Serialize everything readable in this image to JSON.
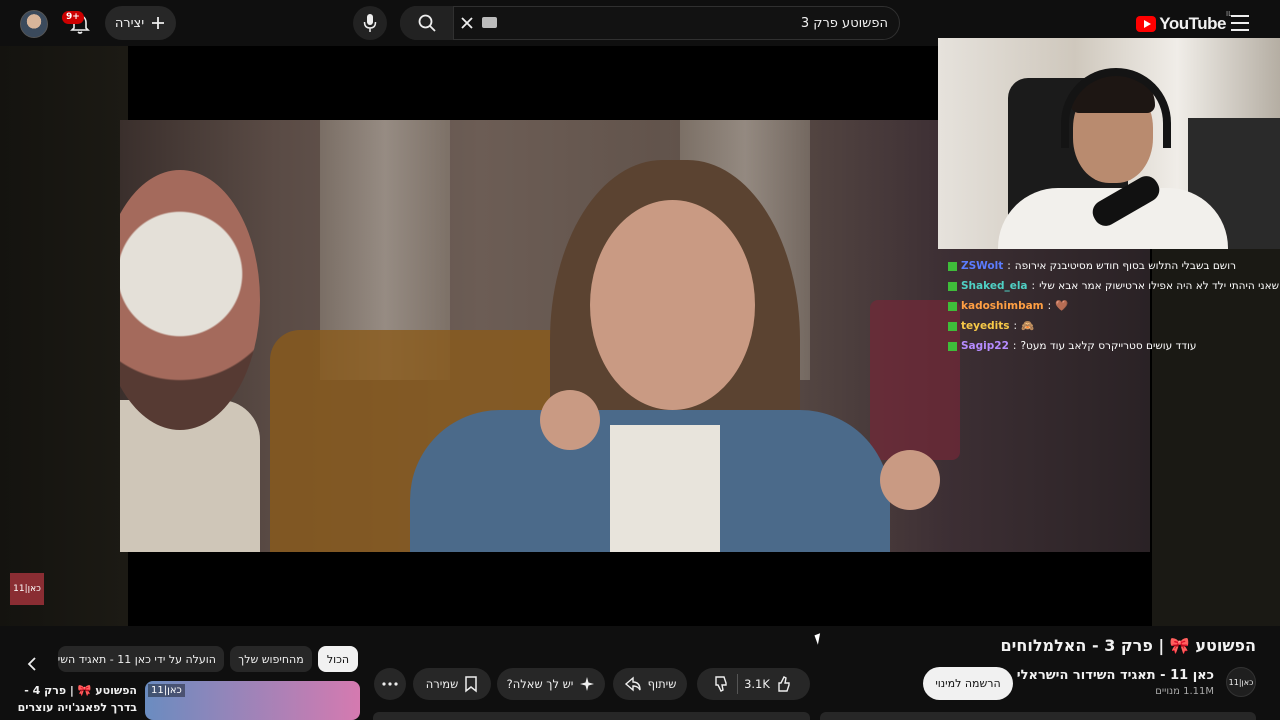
{
  "header": {
    "notifications_badge": "9+",
    "create_label": "יצירה",
    "search_value": "הפשוטע פרק 3",
    "logo_text": "YouTube",
    "logo_country": "IL"
  },
  "chat": [
    {
      "user": "ZSWolt",
      "user_color": "#5b7cff",
      "message": "רושם בשבלי התלוש בסוף חודש מסיטיבנק אירופה"
    },
    {
      "user": "Shaked_ela",
      "user_color": "#4fd1c5",
      "message": "שאני היהתי ילד לא היה אפילו ארטישוק אמר אבא שלי"
    },
    {
      "user": "kadoshimbam",
      "user_color": "#ff9f43",
      "message": "🤎"
    },
    {
      "user": "teyedits",
      "user_color": "#f7c948",
      "message": "🙈"
    },
    {
      "user": "Sagip22",
      "user_color": "#b68cff",
      "message": "עודד עושים סטרייקרס קלאב עוד מעט?"
    }
  ],
  "overlay": {
    "kan_logo": "כאן|11"
  },
  "video": {
    "title_prefix": "הפשוטע",
    "title_suffix": "| פרק 3 - האלמלוחים",
    "channel_name": "כאן 11 - תאגיד השידור הישראלי",
    "channel_avatar": "כאן|11",
    "subscribers": "1.11M מנויים",
    "subscribe_label": "הרשמה למינוי",
    "likes": "3.1K",
    "share_label": "שיתוף",
    "ask_label": "יש לך שאלה?",
    "save_label": "שמירה"
  },
  "recommendations": {
    "chips": [
      "הכול",
      "מהחיפוש שלך",
      "הועלה על ידי כאן 11 - תאגיד השידור"
    ],
    "item_title": "הפשוטע 🎀 | פרק 4 - בדרך לפאנג'ויה עוצרים",
    "item_thumb_logo": "כאן|11"
  },
  "colors": {
    "background": "#0f0f0f",
    "accent_red": "#ff0000",
    "pill_bg": "#272727"
  }
}
